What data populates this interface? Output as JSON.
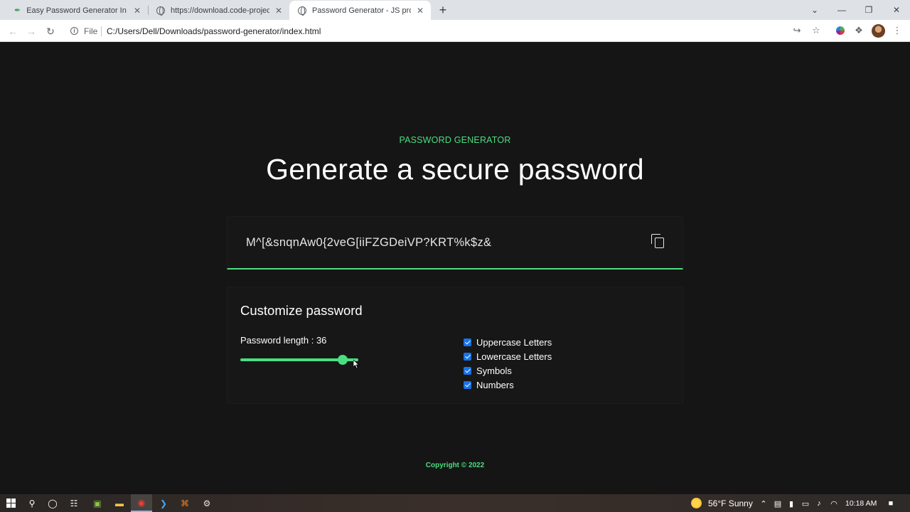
{
  "browser": {
    "tabs": [
      {
        "title": "Easy Password Generator In Java",
        "active": false,
        "icon": "feather-icon"
      },
      {
        "title": "https://download.code-projects.o",
        "active": false,
        "icon": "globe-icon"
      },
      {
        "title": "Password Generator - JS projects",
        "active": true,
        "icon": "globe-icon"
      }
    ],
    "url_scheme": "File",
    "url": "C:/Users/Dell/Downloads/password-generator/index.html"
  },
  "page": {
    "eyebrow": "PASSWORD GENERATOR",
    "headline": "Generate a secure password",
    "password": "M^[&snqnAw0{2veG[iiFZGDeiVP?KRT%k$z&",
    "customize": {
      "title": "Customize password",
      "length_label": "Password length : 36",
      "length_value": 36,
      "slider_fraction": 0.87,
      "options": [
        {
          "label": "Uppercase Letters",
          "checked": true
        },
        {
          "label": "Lowercase Letters",
          "checked": true
        },
        {
          "label": "Symbols",
          "checked": true
        },
        {
          "label": "Numbers",
          "checked": true
        }
      ]
    },
    "copyright": "Copyright © 2022"
  },
  "taskbar": {
    "weather": "56°F  Sunny",
    "time": "10:18 AM"
  },
  "colors": {
    "accent": "#4ade80",
    "page_bg": "#151515",
    "checkbox": "#1a73e8"
  }
}
